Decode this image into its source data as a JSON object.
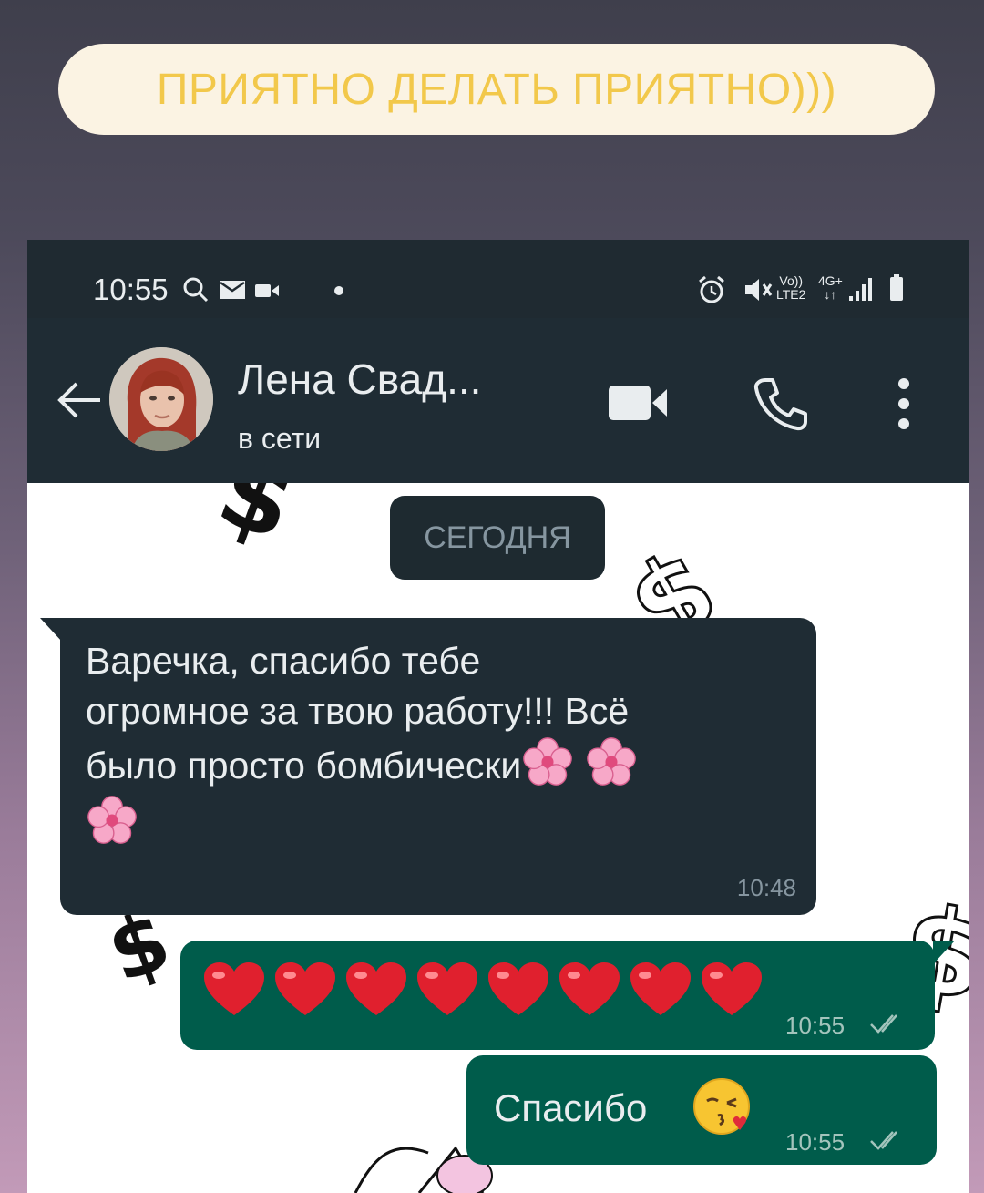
{
  "caption": {
    "text": "ПРИЯТНО ДЕЛАТЬ ПРИЯТНО)))"
  },
  "status_bar": {
    "time": "10:55",
    "left_icons": [
      "search-icon",
      "mail-icon",
      "video-icon",
      "dot-icon"
    ],
    "right_icons": [
      "alarm-icon",
      "mute-icon",
      "volte-icon",
      "4g-icon",
      "signal-icon",
      "battery-icon"
    ],
    "volte_label_top": "Vo))",
    "volte_label_bottom": "LTE2",
    "network_label": "4G+"
  },
  "chat_header": {
    "contact_name": "Лена Свад...",
    "status": "в сети",
    "icons": [
      "back-arrow-icon",
      "video-call-icon",
      "phone-call-icon",
      "more-options-icon"
    ]
  },
  "date_chip": "СЕГОДНЯ",
  "messages": [
    {
      "direction": "incoming",
      "text_line1": "Варечка, спасибо тебе",
      "text_line2": "огромное за твою работу!!! Всё",
      "text_line3": "было просто бомбически",
      "emoji": "cherry-blossom-icon",
      "time": "10:48"
    },
    {
      "direction": "outgoing",
      "emoji": "red-heart-icon",
      "emoji_count": 8,
      "time": "10:55",
      "status": "read"
    },
    {
      "direction": "outgoing",
      "text": "Спасибо",
      "emoji": "kissing-face-icon",
      "time": "10:55",
      "status": "read"
    }
  ],
  "colors": {
    "header_bg": "#1f2c34",
    "incoming_bubble": "#1f2c34",
    "outgoing_bubble": "#005c4b",
    "caption_text": "#f2c84b",
    "caption_bg": "#fbf3e3"
  }
}
